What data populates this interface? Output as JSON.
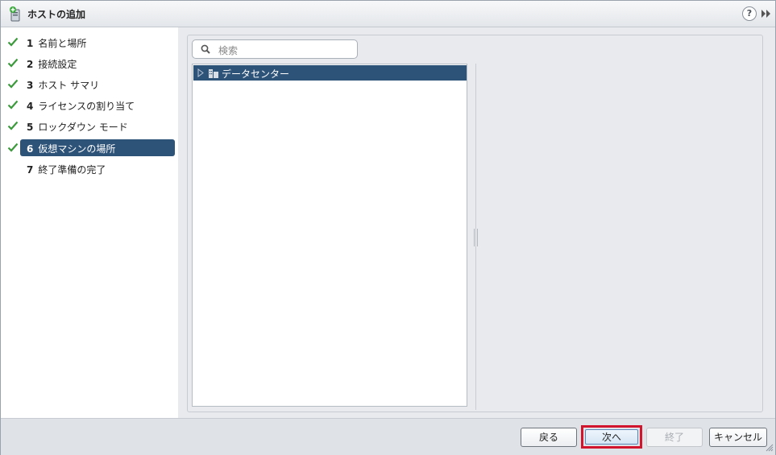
{
  "window": {
    "title": "ホストの追加",
    "help_glyph": "?"
  },
  "steps": [
    {
      "number": "1",
      "label": "名前と場所",
      "completed": true,
      "active": false
    },
    {
      "number": "2",
      "label": "接続設定",
      "completed": true,
      "active": false
    },
    {
      "number": "3",
      "label": "ホスト サマリ",
      "completed": true,
      "active": false
    },
    {
      "number": "4",
      "label": "ライセンスの割り当て",
      "completed": true,
      "active": false
    },
    {
      "number": "5",
      "label": "ロックダウン モード",
      "completed": true,
      "active": false
    },
    {
      "number": "6",
      "label": "仮想マシンの場所",
      "completed": true,
      "active": true
    },
    {
      "number": "7",
      "label": "終了準備の完了",
      "completed": false,
      "active": false
    }
  ],
  "search": {
    "placeholder": "検索"
  },
  "tree": {
    "items": [
      {
        "label": "データセンター",
        "icon": "datacenter-icon",
        "expanded": false,
        "selected": true
      }
    ]
  },
  "footer": {
    "back_label": "戻る",
    "next_label": "次へ",
    "finish_label": "終了",
    "cancel_label": "キャンセル"
  },
  "colors": {
    "selection": "#2e5379",
    "check": "#3c9a3c",
    "highlight": "#d2142c"
  }
}
